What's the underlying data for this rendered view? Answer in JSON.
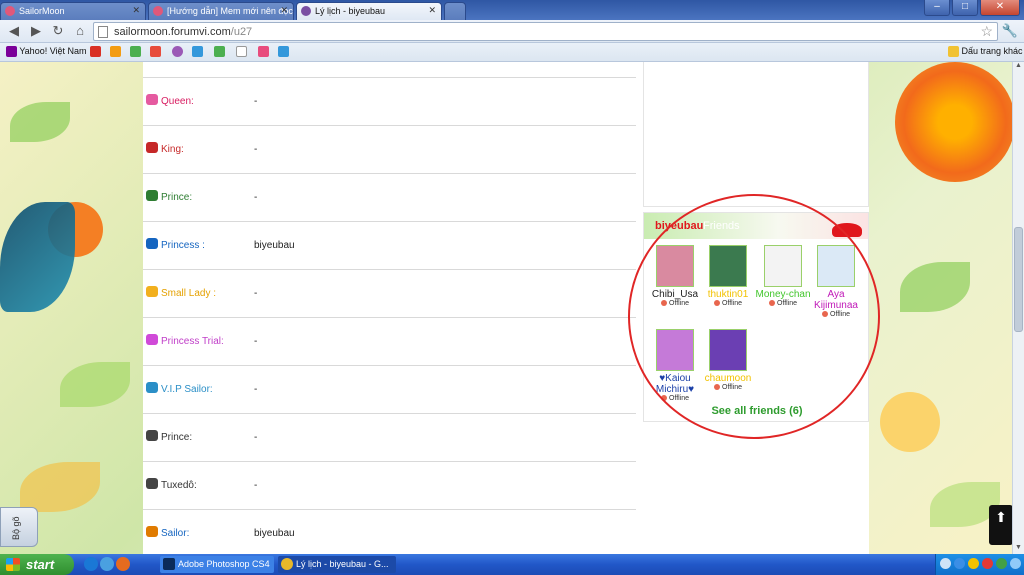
{
  "browser": {
    "tabs": [
      {
        "title": "SailorMoon",
        "active": false
      },
      {
        "title": "[Hướng dẫn] Mem mới nên đọc",
        "active": false
      },
      {
        "title": "Lý lịch - biyeubau",
        "active": true
      }
    ],
    "url_host": "sailormoon.forumvi.com",
    "url_path": "/u27",
    "bookmarks": {
      "yahoo": "Yahoo! Việt Nam",
      "other": "Dấu trang khác"
    }
  },
  "profile_rows": [
    {
      "label": "Queen:",
      "value": "-",
      "color": "#d81b60",
      "icon_color": "#e55aa0"
    },
    {
      "label": "King:",
      "value": "-",
      "color": "#c62828",
      "icon_color": "#c62828"
    },
    {
      "label": "Prince:",
      "value": "-",
      "color": "#2e7d32",
      "icon_color": "#2e7d32"
    },
    {
      "label": "Princess :",
      "value": "biyeubau",
      "color": "#1565c0",
      "icon_color": "#1565c0"
    },
    {
      "label": "Small Lady :",
      "value": "-",
      "color": "#e5a100",
      "icon_color": "#f2b01e"
    },
    {
      "label": "Princess Trial:",
      "value": "-",
      "color": "#c03ec8",
      "icon_color": "#d04ad8"
    },
    {
      "label": "V.I.P Sailor:",
      "value": "-",
      "color": "#2b8fc7",
      "icon_color": "#2b8fc7"
    },
    {
      "label": "Prince:",
      "value": "-",
      "color": "#333333",
      "icon_color": "#444444"
    },
    {
      "label": "Tuxedô:",
      "value": "-",
      "color": "#333333",
      "icon_color": "#444444"
    },
    {
      "label": "Sailor:",
      "value": "biyeubau",
      "color": "#1565c0",
      "icon_color": "#e07b00"
    }
  ],
  "friends": {
    "username": "biyeubau",
    "title": "Friends",
    "list": [
      {
        "name": "Chibi_Usa",
        "status": "Offline",
        "color": "#222222",
        "avatar": "#d98aa0"
      },
      {
        "name": "thuktin01",
        "status": "Offline",
        "color": "#f2c200",
        "avatar": "#3b7a4f"
      },
      {
        "name": "Money-chan",
        "status": "Offline",
        "color": "#43c62d",
        "avatar": "#f3f3f3"
      },
      {
        "name": "Aya Kijimunaa",
        "status": "Offline",
        "color": "#c01ab8",
        "avatar": "#dbe9f6"
      },
      {
        "name": "♥Kaiou Michiru♥",
        "status": "Offline",
        "color": "#1a3fa8",
        "avatar": "#c57ad8"
      },
      {
        "name": "chaumoon",
        "status": "Offline",
        "color": "#f2c200",
        "avatar": "#6b3fb3"
      }
    ],
    "see_all": "See all friends (6)"
  },
  "side_button": "Bộ gõ",
  "taskbar": {
    "start": "start",
    "tasks": [
      "Adobe Photoshop CS4",
      "Lý lịch - biyeubau - G..."
    ]
  }
}
